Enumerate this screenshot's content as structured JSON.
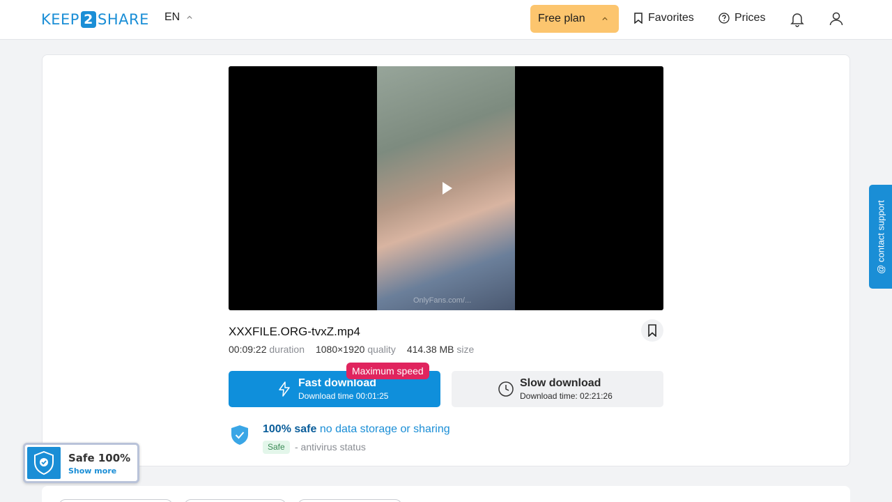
{
  "header": {
    "logo": {
      "left": "KEEP",
      "num": "2",
      "right": "SHARE"
    },
    "language": "EN",
    "plan_label": "Free plan",
    "favorites_label": "Favorites",
    "prices_label": "Prices",
    "icons": [
      "bookmark-icon",
      "question-icon",
      "bell-icon",
      "user-icon"
    ]
  },
  "file": {
    "name": "XXXFILE.ORG-tvxZ.mp4",
    "duration_value": "00:09:22",
    "duration_label": "duration",
    "quality_value": "1080×1920",
    "quality_label": "quality",
    "size_value": "414.38 MB",
    "size_label": "size",
    "watermark": "OnlyFans.com/..."
  },
  "downloads": {
    "badge": "Maximum speed",
    "fast_title": "Fast download",
    "fast_sub": "Download time 00:01:25",
    "slow_title": "Slow download",
    "slow_sub": "Download time: 02:21:26"
  },
  "safety": {
    "strong": "100% safe",
    "rest": "no data storage or sharing",
    "pill": "Safe",
    "status": "- antivirus status"
  },
  "widget": {
    "title": "Safe 100%",
    "link": "Show more"
  },
  "support_label": "@ contact support",
  "colors": {
    "primary": "#0f8fdb",
    "plan": "#fcc56e",
    "badge": "#e0245e",
    "safe_pill_bg": "#e3f6ea"
  }
}
